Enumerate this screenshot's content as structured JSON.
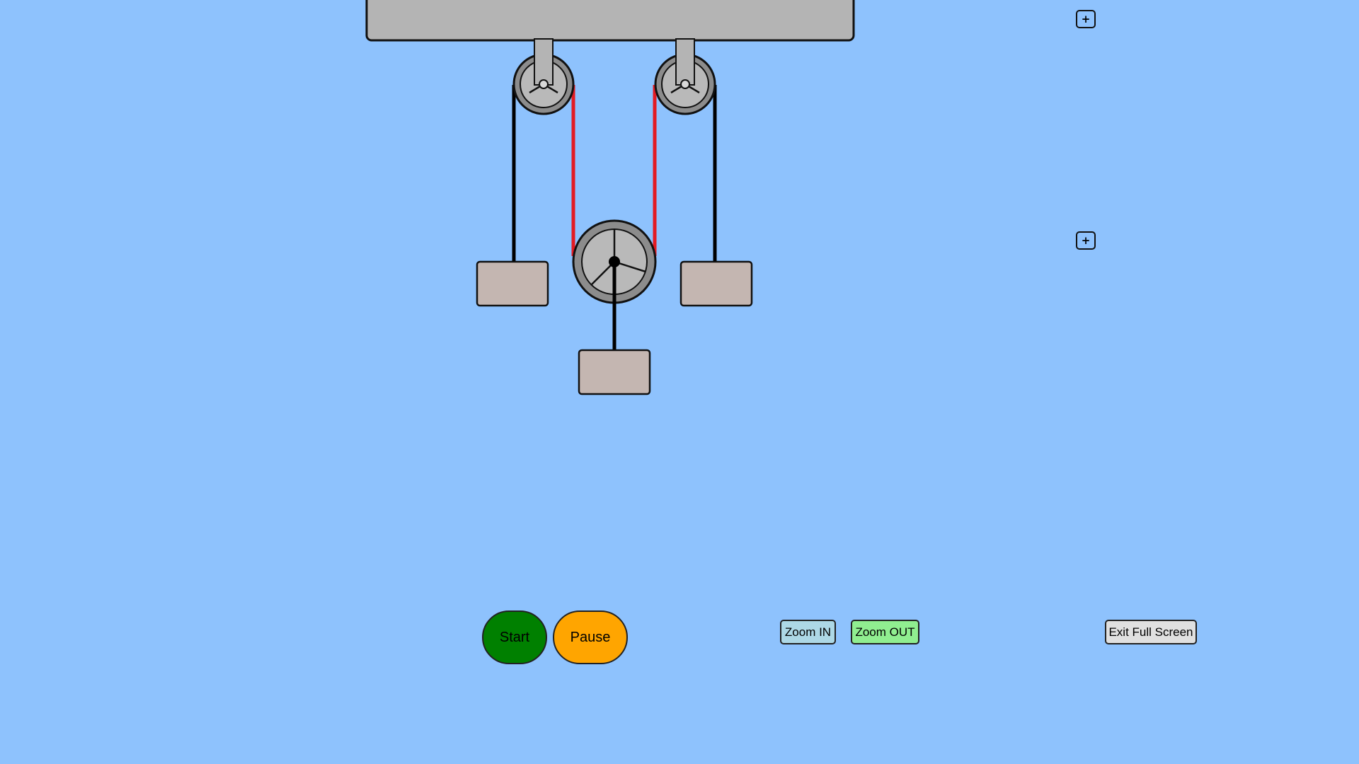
{
  "controls": {
    "start_label": "Start",
    "pause_label": "Pause",
    "zoom_in_label": "Zoom IN",
    "zoom_out_label": "Zoom OUT",
    "exit_fullscreen_label": "Exit Full Screen",
    "expand_top_label": "+",
    "expand_middle_label": "+"
  },
  "colors": {
    "background": "#8ec2fd",
    "ceiling": "#b4b4b4",
    "pulley_outer": "#8c8c8c",
    "pulley_inner": "#b9b9b9",
    "block_fill": "#c4b6b1",
    "rope": "#000000",
    "rope_highlight": "#e31b23",
    "start_button": "#008000",
    "pause_button": "#ffa500",
    "zoom_in_button": "#add8e6",
    "zoom_out_button": "#90ee90",
    "exit_button": "#e0e0e0"
  }
}
